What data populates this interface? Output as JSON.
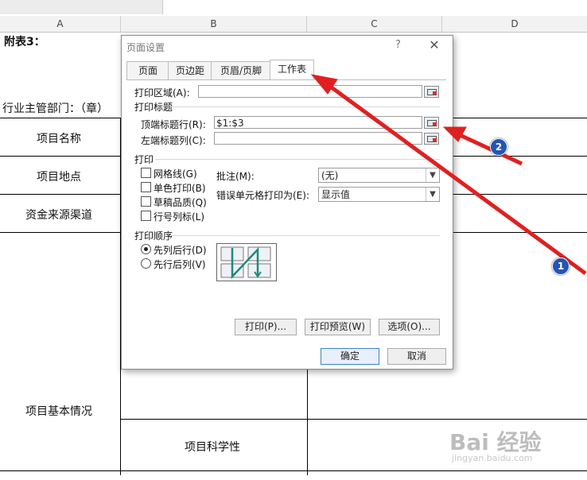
{
  "spreadsheet": {
    "columns": [
      "A",
      "B",
      "C",
      "D"
    ],
    "cells": {
      "attachment": "附表3：",
      "department": "行业主管部门：（章）",
      "project_name": "项目名称",
      "project_location": "项目地点",
      "fund_source": "资金来源渠道",
      "project_basic": "项目基本情况",
      "project_scientific": "项目科学性"
    }
  },
  "dialog": {
    "title": "页面设置",
    "help": "?",
    "close": "✕",
    "tabs": [
      "页面",
      "页边距",
      "页眉/页脚",
      "工作表"
    ],
    "active_tab": "工作表",
    "print_area_label": "打印区域(A):",
    "print_area_value": "",
    "print_titles_label": "打印标题",
    "rows_repeat_label": "顶端标题行(R):",
    "rows_repeat_value": "$1:$3",
    "cols_repeat_label": "左端标题列(C):",
    "cols_repeat_value": "",
    "print_section_label": "打印",
    "checkboxes": [
      "网格线(G)",
      "单色打印(B)",
      "草稿品质(Q)",
      "行号列标(L)"
    ],
    "comments_label": "批注(M):",
    "comments_value": "(无)",
    "errors_label": "错误单元格打印为(E):",
    "errors_value": "显示值",
    "order_label": "打印顺序",
    "order_options": [
      "先列后行(D)",
      "先行后列(V)"
    ],
    "order_selected": "先列后行(D)",
    "btn_print": "打印(P)...",
    "btn_preview": "打印预览(W)",
    "btn_options": "选项(O)...",
    "btn_ok": "确定",
    "btn_cancel": "取消"
  },
  "annotations": {
    "badge1": "1",
    "badge2": "2",
    "arrow_color": "#e02020",
    "badge_color": "#2455b4"
  },
  "watermark": {
    "main": "Bai 经验",
    "sub": "jingyan.baidu.com"
  }
}
